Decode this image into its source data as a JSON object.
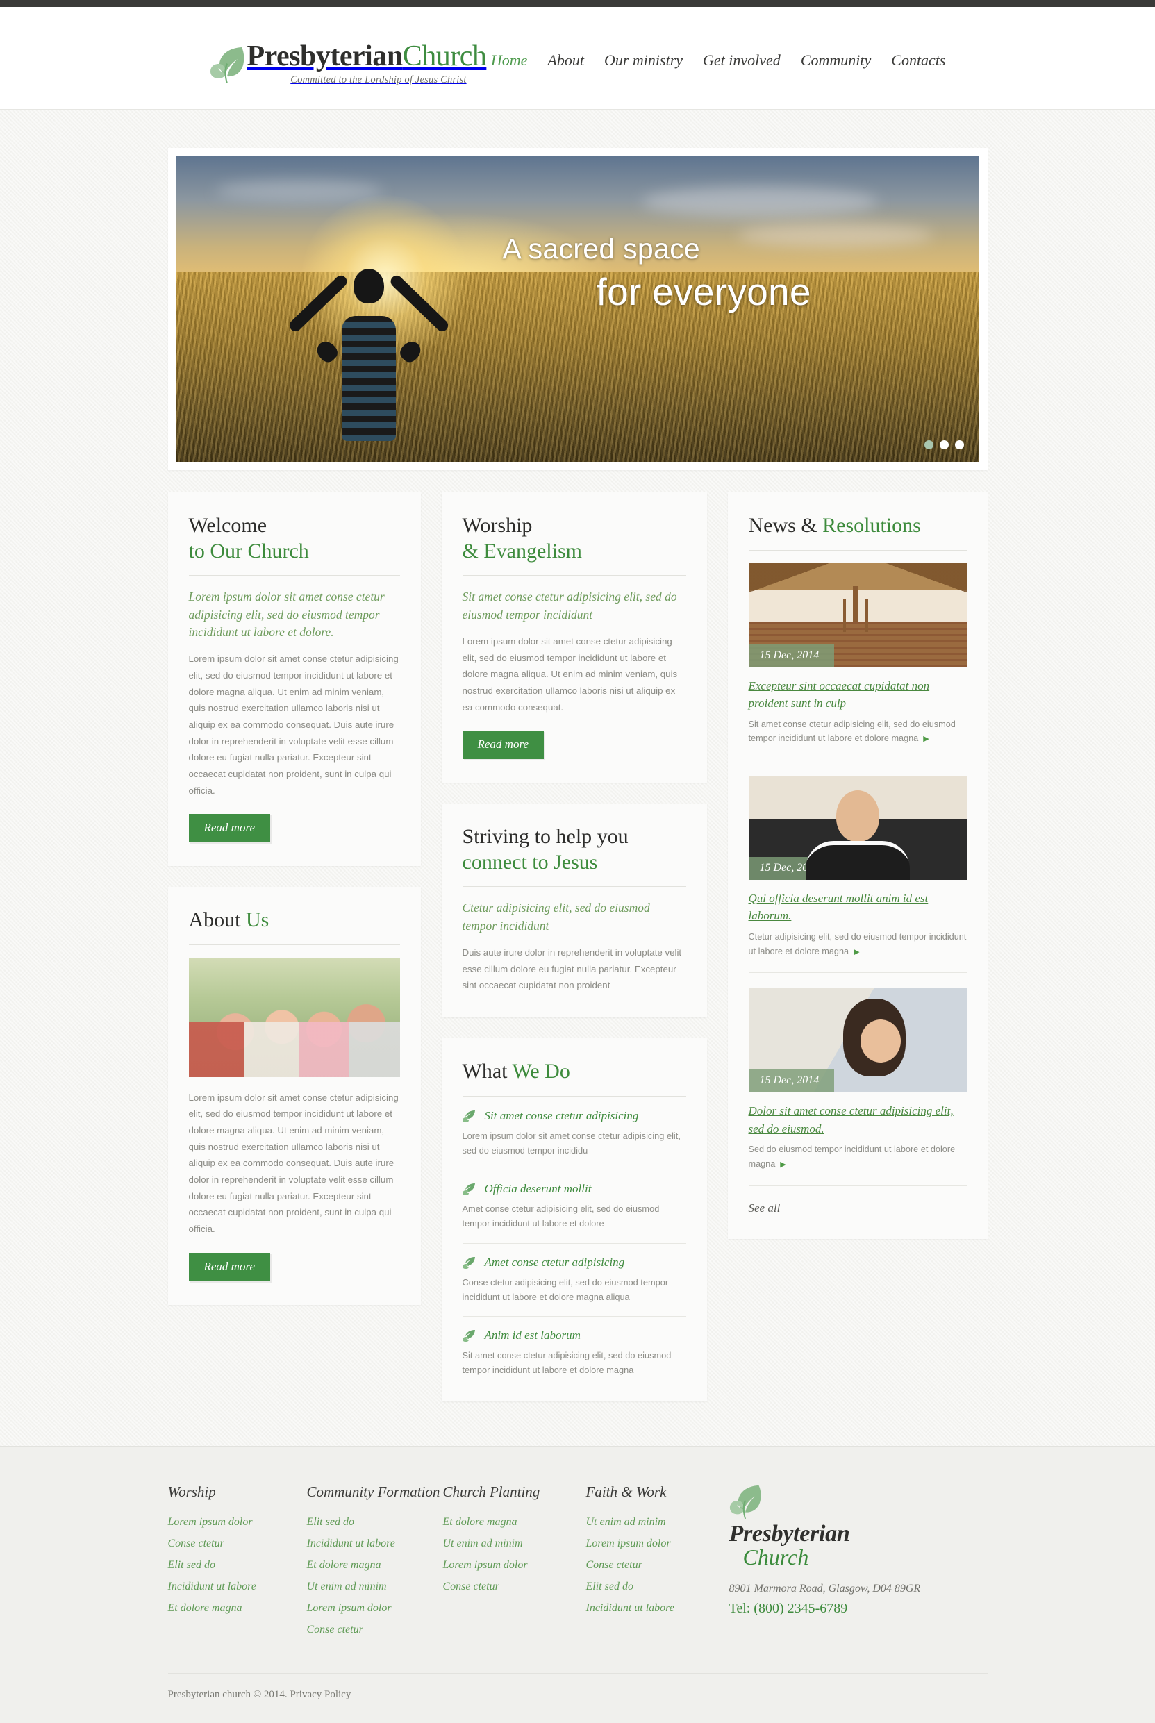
{
  "brand": {
    "name_bold": "Presbyterian",
    "name_light": "Church",
    "tagline": "Committed to the Lordship of Jesus Christ",
    "logo_icon": "leaf-icon"
  },
  "nav": {
    "items": [
      {
        "label": "Home",
        "active": true
      },
      {
        "label": "About",
        "active": false
      },
      {
        "label": "Our ministry",
        "active": false
      },
      {
        "label": "Get involved",
        "active": false
      },
      {
        "label": "Community",
        "active": false
      },
      {
        "label": "Contacts",
        "active": false
      }
    ]
  },
  "hero": {
    "caption_line1": "A sacred space",
    "caption_line2": "for everyone",
    "slides": [
      {
        "active": true
      },
      {
        "active": false
      },
      {
        "active": false
      }
    ]
  },
  "welcome": {
    "title_dark": "Welcome",
    "title_green": "to Our Church",
    "lead": "Lorem ipsum dolor sit amet conse ctetur adipisicing elit, sed do eiusmod tempor incididunt ut labore et dolore.",
    "body": "Lorem ipsum dolor sit amet conse ctetur adipisicing elit, sed do eiusmod tempor incididunt ut labore et dolore magna aliqua. Ut enim ad minim veniam, quis nostrud exercitation ullamco laboris nisi ut aliquip ex ea commodo consequat. Duis aute irure dolor in reprehenderit in voluptate velit esse cillum dolore eu fugiat nulla pariatur. Excepteur sint occaecat cupidatat non proident, sunt in culpa qui officia.",
    "button": "Read more"
  },
  "about": {
    "title_dark": "About",
    "title_green": "Us",
    "image_alt": "family-photo",
    "body": "Lorem ipsum dolor sit amet conse ctetur adipisicing elit, sed do eiusmod tempor incididunt ut labore et dolore magna aliqua. Ut enim ad minim veniam, quis nostrud exercitation ullamco laboris nisi ut aliquip ex ea commodo consequat. Duis aute irure dolor in reprehenderit in voluptate velit esse cillum dolore eu fugiat nulla pariatur. Excepteur sint occaecat cupidatat non proident, sunt in culpa qui officia.",
    "button": "Read more"
  },
  "worship": {
    "title_dark": "Worship",
    "title_green": "& Evangelism",
    "lead": "Sit amet conse ctetur adipisicing elit, sed do eiusmod tempor incididunt",
    "body": "Lorem ipsum dolor sit amet conse ctetur adipisicing elit, sed do eiusmod tempor incididunt ut labore et dolore magna aliqua. Ut enim ad minim veniam, quis nostrud exercitation ullamco laboris nisi ut aliquip ex ea commodo consequat.",
    "button": "Read more"
  },
  "striving": {
    "title_dark": "Striving to help you",
    "title_green": "connect to Jesus",
    "lead": "Ctetur adipisicing elit, sed do eiusmod tempor incididunt",
    "body": "Duis aute irure dolor in reprehenderit in voluptate velit esse cillum dolore eu fugiat nulla pariatur. Excepteur sint occaecat cupidatat non proident"
  },
  "what_we_do": {
    "title_dark": "What",
    "title_green": "We Do",
    "items": [
      {
        "icon": "leaf-icon",
        "title": "Sit amet conse ctetur adipisicing",
        "text": "Lorem ipsum dolor sit amet conse ctetur adipisicing elit, sed do eiusmod tempor incididu"
      },
      {
        "icon": "leaf-icon",
        "title": "Officia deserunt mollit",
        "text": "Amet conse ctetur adipisicing elit, sed do eiusmod tempor incididunt ut labore et dolore"
      },
      {
        "icon": "leaf-icon",
        "title": "Amet conse ctetur adipisicing",
        "text": "Conse ctetur adipisicing elit, sed do eiusmod tempor incididunt ut labore et dolore magna aliqua"
      },
      {
        "icon": "leaf-icon",
        "title": "Anim id est laborum",
        "text": "Sit amet conse ctetur adipisicing elit, sed do eiusmod tempor incididunt ut labore et dolore magna"
      }
    ]
  },
  "news": {
    "title_dark": "News &",
    "title_green": "Resolutions",
    "items": [
      {
        "image": "church-interior-photo",
        "date": "15 Dec, 2014",
        "title": "Excepteur sint occaecat cupidatat non proident sunt in culp",
        "text": "Sit amet conse ctetur adipisicing elit, sed do eiusmod tempor incididunt ut labore et dolore magna",
        "arrow": "▶"
      },
      {
        "image": "priest-photo",
        "date": "15 Dec, 2014",
        "title": "Qui officia deserunt mollit anim id est laborum.",
        "text": "Ctetur adipisicing elit, sed do eiusmod tempor incididunt ut labore et dolore magna",
        "arrow": "▶"
      },
      {
        "image": "woman-photo",
        "date": "15 Dec, 2014",
        "title": "Dolor sit amet conse ctetur adipisicing elit, sed do eiusmod.",
        "text": "Sed do eiusmod tempor incididunt ut labore et dolore magna",
        "arrow": "▶"
      }
    ],
    "see_all": "See all"
  },
  "footer": {
    "columns": [
      {
        "heading": "Worship",
        "links": [
          "Lorem ipsum dolor",
          "Conse ctetur",
          "Elit sed do",
          "Incididunt ut labore",
          "Et dolore magna"
        ]
      },
      {
        "heading": "Community Formation",
        "links": [
          "Elit sed do",
          "Incididunt ut labore",
          "Et dolore magna",
          "Ut enim ad minim",
          "Lorem ipsum dolor",
          "Conse ctetur"
        ]
      },
      {
        "heading": "Church Planting",
        "links": [
          "Et dolore magna",
          "Ut enim ad minim",
          "Lorem ipsum dolor",
          "Conse ctetur"
        ]
      },
      {
        "heading": "Faith & Work",
        "links": [
          "Ut enim ad minim",
          "Lorem ipsum dolor",
          "Conse ctetur",
          "Elit sed do",
          "Incididunt ut labore"
        ]
      }
    ],
    "brand_line1": "Presbyterian",
    "brand_line2": "Church",
    "address": "8901 Marmora Road, Glasgow, D04 89GR",
    "telephone": "Tel: (800) 2345-6789",
    "copyright": "Presbyterian church © 2014.",
    "privacy": "Privacy Policy"
  },
  "colors": {
    "brand_green": "#3e8c40",
    "leaf_light": "#8cbb8c",
    "button_green": "#3f8f43",
    "text_dark": "#2f2f2d",
    "body_gray": "#8b8b85",
    "date_badge": "#7e9e78"
  }
}
